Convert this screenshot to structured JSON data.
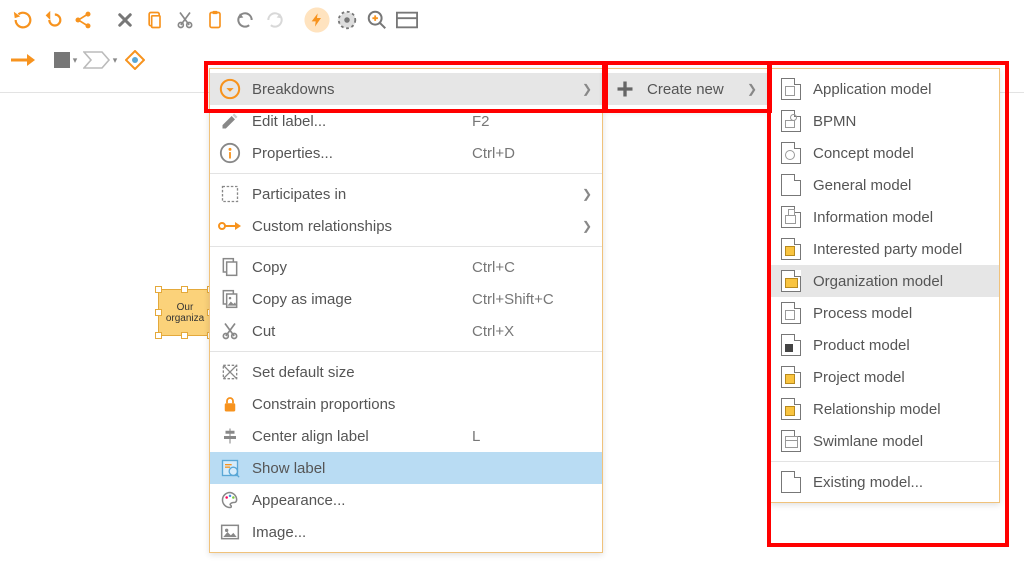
{
  "canvas": {
    "selected_shape_label": "Our organiza"
  },
  "context_menu": {
    "items": [
      {
        "icon": "breakdowns",
        "label": "Breakdowns",
        "hotkey": "",
        "submenu": true,
        "highlight": true
      },
      {
        "icon": "edit",
        "label": "Edit label...",
        "hotkey": "F2"
      },
      {
        "icon": "info",
        "label": "Properties...",
        "hotkey": "Ctrl+D"
      },
      {
        "sep": true
      },
      {
        "icon": "partic",
        "label": "Participates in",
        "hotkey": "",
        "submenu": true
      },
      {
        "icon": "relarrow",
        "label": "Custom relationships",
        "hotkey": "",
        "submenu": true
      },
      {
        "sep": true
      },
      {
        "icon": "copy",
        "label": "Copy",
        "hotkey": "Ctrl+C"
      },
      {
        "icon": "copyimg",
        "label": "Copy as image",
        "hotkey": "Ctrl+Shift+C"
      },
      {
        "icon": "cut",
        "label": "Cut",
        "hotkey": "Ctrl+X"
      },
      {
        "sep": true
      },
      {
        "icon": "defsize",
        "label": "Set default size",
        "hotkey": ""
      },
      {
        "icon": "lock",
        "label": "Constrain proportions",
        "hotkey": ""
      },
      {
        "icon": "center",
        "label": "Center align label",
        "hotkey": "L"
      },
      {
        "icon": "showlabel",
        "label": "Show label",
        "hotkey": "",
        "active": true
      },
      {
        "icon": "palette",
        "label": "Appearance...",
        "hotkey": ""
      },
      {
        "icon": "image",
        "label": "Image...",
        "hotkey": ""
      }
    ],
    "breakdowns_submenu": {
      "items": [
        {
          "icon": "plus",
          "label": "Create new",
          "submenu": true
        }
      ]
    },
    "create_new_submenu": {
      "items": [
        {
          "deco": "white",
          "label": "Application model"
        },
        {
          "deco": "bpmn",
          "label": "BPMN"
        },
        {
          "deco": "concept",
          "label": "Concept model"
        },
        {
          "deco": "blank",
          "label": "General model"
        },
        {
          "deco": "info",
          "label": "Information model"
        },
        {
          "deco": "yellow",
          "label": "Interested party model"
        },
        {
          "deco": "folder",
          "label": "Organization model",
          "highlight": true
        },
        {
          "deco": "white",
          "label": "Process model"
        },
        {
          "deco": "black",
          "label": "Product model"
        },
        {
          "deco": "yellow",
          "label": "Project model"
        },
        {
          "deco": "yellow",
          "label": "Relationship model"
        },
        {
          "deco": "swim",
          "label": "Swimlane model"
        },
        {
          "sep": true
        },
        {
          "deco": "blank",
          "label": "Existing model..."
        }
      ]
    }
  }
}
